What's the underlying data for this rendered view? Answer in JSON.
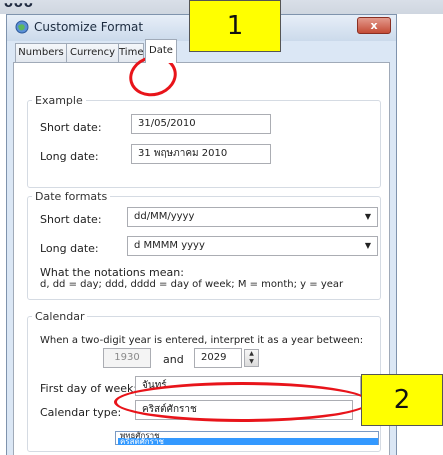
{
  "window": {
    "title": "Customize Format",
    "close": "x"
  },
  "tabs": [
    {
      "label": "Numbers"
    },
    {
      "label": "Currency"
    },
    {
      "label": "Time"
    },
    {
      "label": "Date"
    }
  ],
  "example": {
    "legend": "Example",
    "short_label": "Short date:",
    "short_value": "31/05/2010",
    "long_label": "Long date:",
    "long_value": "31 พฤษภาคม 2010"
  },
  "formats": {
    "legend": "Date formats",
    "short_label": "Short date:",
    "short_value": "dd/MM/yyyy",
    "long_label": "Long date:",
    "long_value": "d MMMM yyyy",
    "notation_title": "What the notations mean:",
    "notation_text": "d, dd = day;  ddd, dddd = day of week;  M = month;  y = year"
  },
  "calendar": {
    "legend": "Calendar",
    "two_digit_text": "When a two-digit year is entered, interpret it as a year between:",
    "year_start": "1930",
    "and_label": "and",
    "year_end": "2029",
    "first_day_label": "First day of week:",
    "first_day_value": "จันทร์",
    "type_label": "Calendar type:",
    "type_value": "คริสต์ศักราช",
    "options": [
      "พุทธศักราช",
      "คริสต์ศักราช"
    ]
  },
  "annotations": {
    "callout1": "1",
    "callout2": "2"
  },
  "colors": {
    "highlight": "#3399ff",
    "annotation_red": "#e8141a",
    "callout_yellow": "#ffff00"
  }
}
